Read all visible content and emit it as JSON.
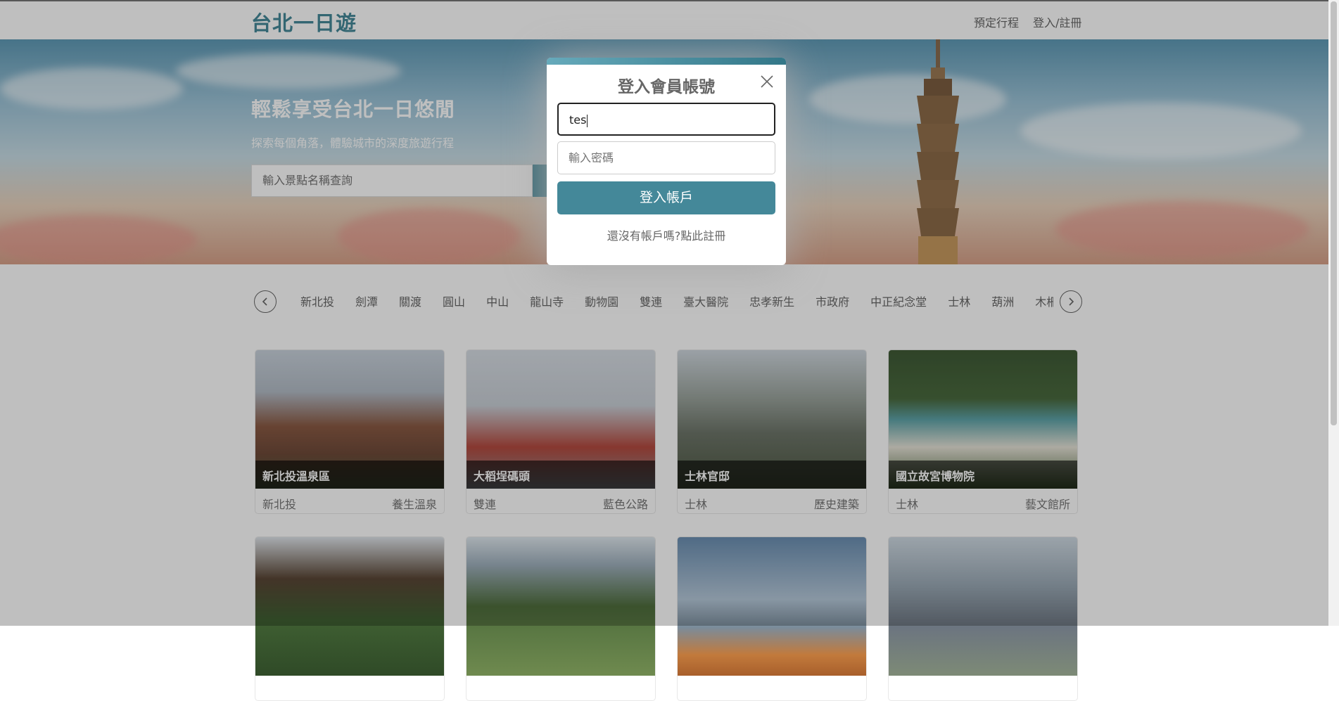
{
  "nav": {
    "brand": "台北一日遊",
    "book_link": "預定行程",
    "login_link": "登入/註冊"
  },
  "hero": {
    "title": "輕鬆享受台北一日悠閒",
    "subtitle": "探索每個角落，體驗城市的深度旅遊行程",
    "search_placeholder": "輸入景點名稱查詢"
  },
  "stations": [
    "新北投",
    "劍潭",
    "關渡",
    "圓山",
    "中山",
    "龍山寺",
    "動物園",
    "雙連",
    "臺大醫院",
    "忠孝新生",
    "市政府",
    "中正紀念堂",
    "士林",
    "葫洲",
    "木柵"
  ],
  "attractions": [
    {
      "name": "新北投溫泉區",
      "mrt": "新北投",
      "category": "養生溫泉"
    },
    {
      "name": "大稻埕碼頭",
      "mrt": "雙連",
      "category": "藍色公路"
    },
    {
      "name": "士林官邸",
      "mrt": "士林",
      "category": "歷史建築"
    },
    {
      "name": "國立故宮博物院",
      "mrt": "士林",
      "category": "藝文館所"
    }
  ],
  "login_modal": {
    "title": "登入會員帳號",
    "username_value": "tes",
    "password_placeholder": "輸入密碼",
    "submit_label": "登入帳戶",
    "switch_text": "還沒有帳戶嗎?點此註冊"
  },
  "colors": {
    "accent": "#448899",
    "text": "#666666",
    "overlay": "rgba(0,0,0,0.25)"
  }
}
